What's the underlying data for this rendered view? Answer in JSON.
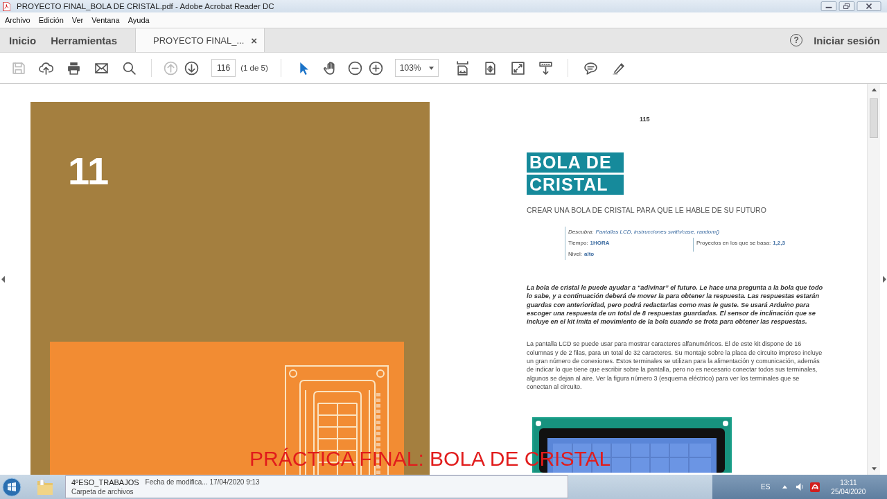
{
  "window": {
    "title": "PROYECTO FINAL_BOLA DE CRISTAL.pdf - Adobe Acrobat Reader DC"
  },
  "menu": [
    "Archivo",
    "Edición",
    "Ver",
    "Ventana",
    "Ayuda"
  ],
  "tabs": [
    {
      "label": "Inicio",
      "selected": false,
      "kind": "home"
    },
    {
      "label": "Herramientas",
      "selected": false,
      "kind": "home"
    },
    {
      "label": "PROYECTO FINAL_...",
      "selected": true,
      "kind": "document",
      "close": "×"
    }
  ],
  "header_right": {
    "help": "?",
    "sign_in": "Iniciar sesión"
  },
  "toolbar": {
    "file_buttons": [
      {
        "kind": "save",
        "disabled": true
      },
      {
        "kind": "upload",
        "disabled": false
      },
      {
        "kind": "print",
        "disabled": false
      },
      {
        "kind": "mail",
        "disabled": false
      },
      {
        "kind": "search",
        "disabled": false
      }
    ],
    "nav_buttons": [
      {
        "kind": "up",
        "disabled": true
      },
      {
        "kind": "down",
        "disabled": false
      }
    ],
    "page_number": "116",
    "page_count": "(1 de 5)",
    "tools": [
      {
        "kind": "select",
        "selected": true
      },
      {
        "kind": "hand",
        "selected": false
      }
    ],
    "zoom_buttons": [
      {
        "kind": "zoom_out"
      },
      {
        "kind": "zoom_in"
      }
    ],
    "zoom": "103%",
    "view_buttons": [
      {
        "kind": "fit_width"
      },
      {
        "kind": "rotate"
      },
      {
        "kind": "fullscreen"
      },
      {
        "kind": "scroll"
      }
    ],
    "comment_buttons": [
      {
        "kind": "comment"
      },
      {
        "kind": "highlight"
      }
    ]
  },
  "left_page": {
    "chapter_number": "11"
  },
  "right_page": {
    "page_number": "115",
    "title_lines": [
      "BOLA DE",
      "CRISTAL"
    ],
    "subtitle": "CREAR UNA BOLA DE CRISTAL PARA QUE LE HABLE DE SU FUTURO",
    "info": {
      "discover_label": "Descubra:",
      "discover_value": "Pantallas LCD, instrucciones swith/case, random()",
      "time_label": "Tiempo:",
      "time_value": "1HORA",
      "level_label": "Nivel:",
      "level_value": "alto",
      "projects_label": "Proyectos en los que se basa:",
      "projects_value": "1,2,3"
    },
    "intro": "La bola de cristal le puede ayudar a “adivinar” el futuro. Le hace una pregunta a la bola que todo lo sabe, y a continuación deberá de mover la para obtener la respuesta. Las respuestas estarán guardas con anterioridad, pero podrá redactarlas como mas le guste. Se usará Arduino para escoger una respuesta de un total de 8 respuestas guardadas. El sensor de inclinación que se incluye en el kit imita el movimiento de la bola cuando se frota para obtener las respuestas.",
    "body": "La pantalla LCD se puede usar para mostrar caracteres alfanuméricos. El de este kit dispone de 16 columnas y de 2 filas, para un total de 32 caracteres. Su montaje sobre la placa de circuito impreso incluye un gran número de conexiones. Estos terminales se utilizan para la alimentación y comunicación, además de indicar lo que tiene que escribir sobre la pantalla, pero no es necesario conectar todos sus terminales, algunos se dejan al aire. Ver la figura número 3 (esquema eléctrico) para ver los terminales que se conectan al circuito."
  },
  "caption": "PRÁCTICA FINAL: BOLA DE CRISTAL",
  "taskbar": {
    "tooltip": {
      "name": "4ºESO_TRABAJOS",
      "detail": "Fecha de modifica... 17/04/2020 9:13",
      "type": "Carpeta de archivos"
    },
    "tray": {
      "language": "ES",
      "time": "13:11",
      "date": "25/04/2020"
    }
  }
}
